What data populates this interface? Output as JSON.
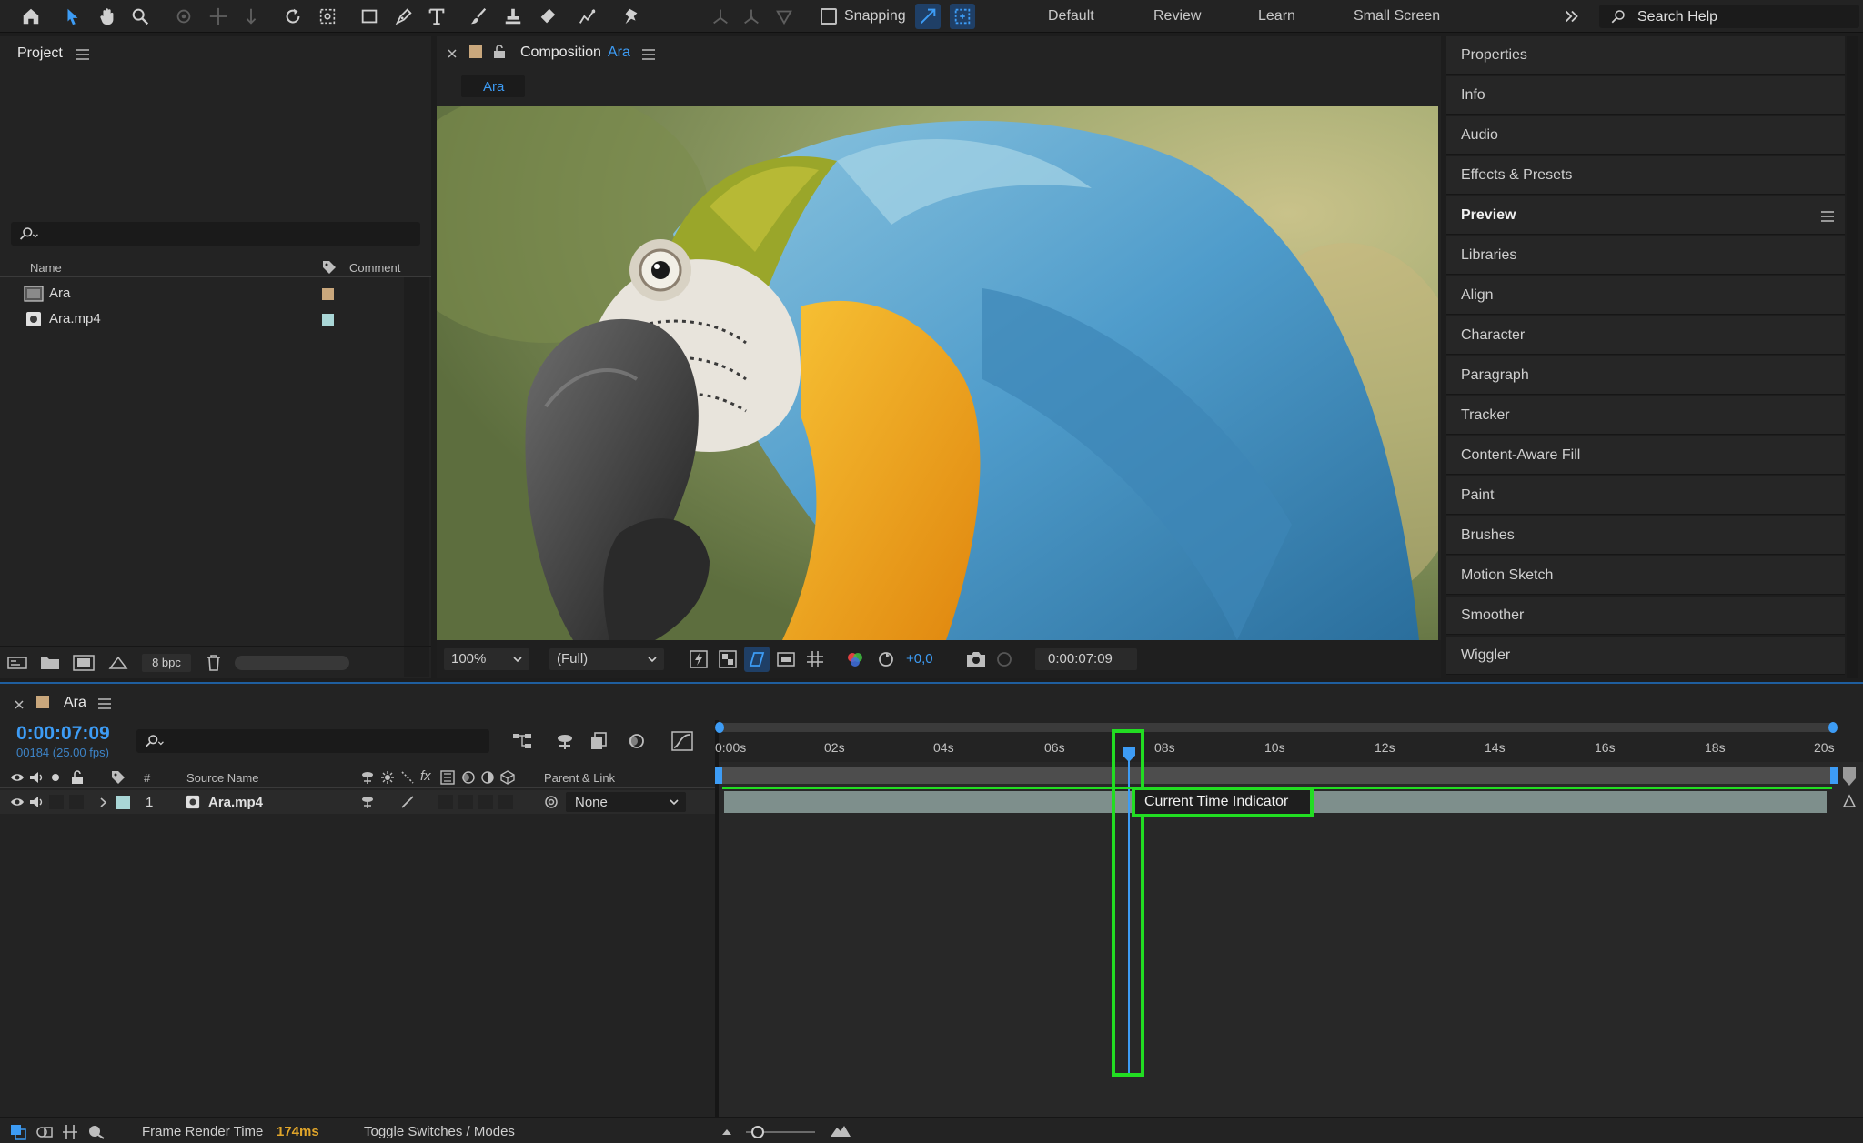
{
  "toolbar": {
    "snapping_label": "Snapping",
    "workspaces": [
      "Default",
      "Review",
      "Learn",
      "Small Screen"
    ],
    "search_placeholder": "Search Help"
  },
  "project": {
    "title": "Project",
    "columns": {
      "name": "Name",
      "comment": "Comment"
    },
    "items": [
      {
        "name": "Ara",
        "label_color": "#c9a77c"
      },
      {
        "name": "Ara.mp4",
        "label_color": "#a9d6d6"
      }
    ],
    "bpc": "8 bpc"
  },
  "composition": {
    "title_prefix": "Composition",
    "title_name": "Ara",
    "tab": "Ara",
    "zoom": "100%",
    "resolution": "(Full)",
    "exposure": "+0,0",
    "timecode": "0:00:07:09"
  },
  "right_panel": {
    "items": [
      "Properties",
      "Info",
      "Audio",
      "Effects & Presets",
      "Preview",
      "Libraries",
      "Align",
      "Character",
      "Paragraph",
      "Tracker",
      "Content-Aware Fill",
      "Paint",
      "Brushes",
      "Motion Sketch",
      "Smoother",
      "Wiggler"
    ],
    "active": "Preview"
  },
  "timeline": {
    "tab": "Ara",
    "timecode": "0:00:07:09",
    "frame_info": "00184 (25.00 fps)",
    "columns": {
      "hash": "#",
      "source_name": "Source Name",
      "parent": "Parent & Link"
    },
    "ruler": [
      "0:00s",
      "02s",
      "04s",
      "06s",
      "08s",
      "10s",
      "12s",
      "14s",
      "16s",
      "18s",
      "20s"
    ],
    "layer": {
      "index": "1",
      "name": "Ara.mp4",
      "parent": "None",
      "label_color": "#a9d6d6"
    },
    "annotation": "Current Time Indicator",
    "footer": {
      "frame_render_label": "Frame Render Time",
      "frame_render_value": "174ms",
      "toggle": "Toggle Switches / Modes"
    }
  },
  "colors": {
    "accent": "#3d9cf5",
    "highlight": "#22dd22",
    "panel": "#232323"
  }
}
